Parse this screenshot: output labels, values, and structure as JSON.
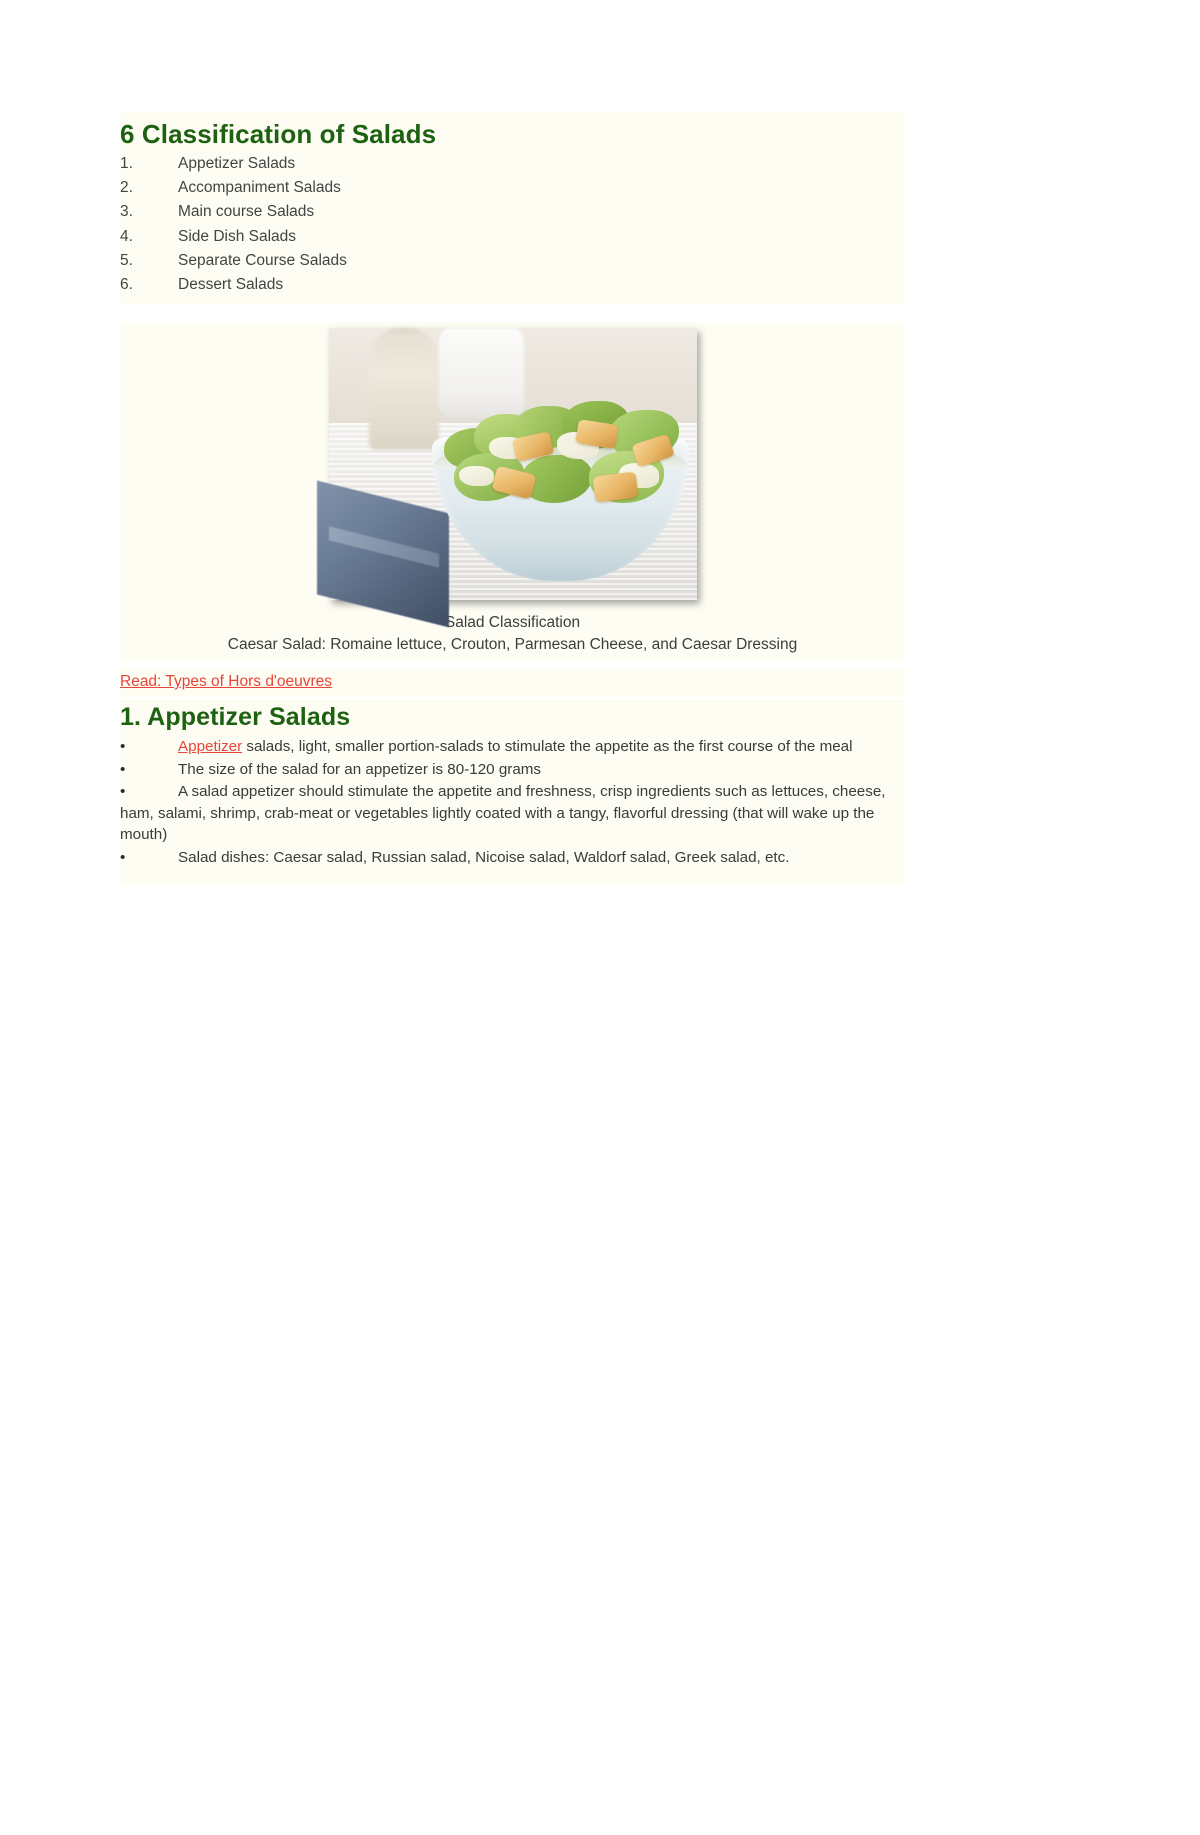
{
  "document": {
    "background_color": "#ffffff",
    "content_tint": "#fdfdf3",
    "heading_color": "#1d6111",
    "link_color": "#e8453c",
    "body_text_color": "#3b3b3b"
  },
  "classification_section": {
    "heading": "6 Classification of Salads",
    "items": [
      {
        "number": "1.",
        "label": "Appetizer Salads"
      },
      {
        "number": "2.",
        "label": "Accompaniment Salads"
      },
      {
        "number": "3.",
        "label": "Main course Salads"
      },
      {
        "number": "4.",
        "label": "Side Dish Salads"
      },
      {
        "number": "5.",
        "label": "Separate Course Salads"
      },
      {
        "number": "6.",
        "label": "Dessert Salads"
      }
    ]
  },
  "figure": {
    "alt": "caesar-salad-photo",
    "caption_line1": "Salad Classification",
    "caption_line2": "Caesar Salad: Romaine lettuce, Crouton, Parmesan Cheese, and Caesar Dressing"
  },
  "read_more_link": {
    "text": "Read: Types of Hors d'oeuvres "
  },
  "appetizer_section": {
    "heading": "1. Appetizer Salads",
    "bullet_glyph": "•",
    "bullets": [
      {
        "link_text": "Appetizer",
        "text": " salads, light, smaller portion-salads to stimulate the appetite as the first course of the meal"
      },
      {
        "link_text": "",
        "text": "The size of the salad for an appetizer is 80-120 grams"
      },
      {
        "link_text": "",
        "text": "A salad appetizer should stimulate the appetite and freshness, crisp ingredients such as lettuces, cheese, ham, salami, shrimp, crab-meat or vegetables lightly coated with a tangy, flavorful dressing (that will wake up the mouth)"
      },
      {
        "link_text": "",
        "text": "Salad dishes: Caesar salad, Russian salad, Nicoise salad, Waldorf salad, Greek salad, etc."
      }
    ]
  }
}
